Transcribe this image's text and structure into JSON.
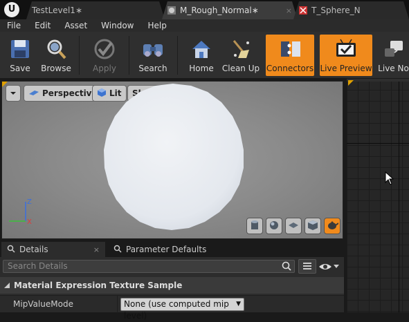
{
  "tabs": [
    {
      "label": "TestLevel1∗",
      "close": ""
    },
    {
      "label": "M_Rough_Normal∗",
      "close": "×"
    },
    {
      "label": "T_Sphere_N",
      "close": ""
    }
  ],
  "menu": [
    "File",
    "Edit",
    "Asset",
    "Window",
    "Help"
  ],
  "toolbar": {
    "save": "Save",
    "browse": "Browse",
    "apply": "Apply",
    "search": "Search",
    "home": "Home",
    "cleanup": "Clean Up",
    "connectors": "Connectors",
    "live_preview": "Live Preview",
    "live_nodes": "Live No"
  },
  "viewport": {
    "perspective": "Perspective",
    "lit": "Lit",
    "show": "Show"
  },
  "axes": {
    "z": "Z",
    "x": "X"
  },
  "details_tabs": [
    {
      "label": "Details",
      "close": "×"
    },
    {
      "label": "Parameter Defaults",
      "close": ""
    }
  ],
  "details": {
    "search_placeholder": "Search Details",
    "category": "Material Expression Texture Sample",
    "property_name": "MipValueMode",
    "property_value": "None (use computed mip level)"
  },
  "colors": {
    "accent": "#f08a1c",
    "orange_corner": "#e0a000"
  },
  "icons": [
    "unreal-logo-icon",
    "material-icon",
    "texture-icon",
    "save-icon",
    "browse-icon",
    "apply-icon",
    "search-icon",
    "home-icon",
    "cleanup-icon",
    "connectors-icon",
    "live-preview-icon",
    "live-nodes-icon",
    "cylinder-icon",
    "sphere-icon",
    "plane-icon",
    "cube-icon",
    "teapot-icon",
    "eye-icon",
    "list-view-icon",
    "magnifier-icon",
    "pointer-cursor-icon"
  ]
}
